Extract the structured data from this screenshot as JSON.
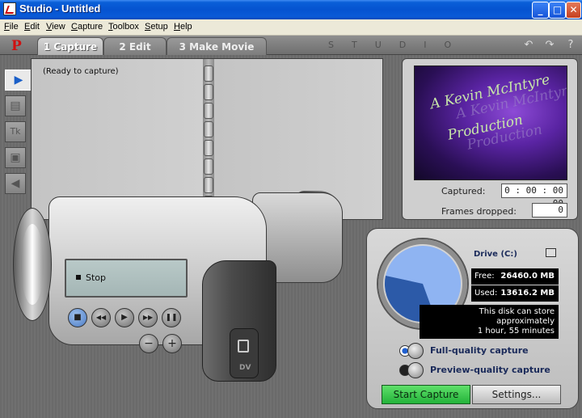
{
  "window": {
    "title": "Studio - Untitled",
    "controls": {
      "minimize": "_",
      "maximize": "□",
      "close": "✕"
    }
  },
  "menu": [
    {
      "label": "File",
      "mnemonic": "F",
      "rest": "ile"
    },
    {
      "label": "Edit",
      "mnemonic": "E",
      "rest": "dit"
    },
    {
      "label": "View",
      "mnemonic": "V",
      "rest": "iew"
    },
    {
      "label": "Capture",
      "mnemonic": "C",
      "rest": "apture"
    },
    {
      "label": "Toolbox",
      "mnemonic": "T",
      "rest": "oolbox"
    },
    {
      "label": "Setup",
      "mnemonic": "S",
      "rest": "etup"
    },
    {
      "label": "Help",
      "mnemonic": "H",
      "rest": "elp"
    }
  ],
  "topbar": {
    "logo": "P",
    "tabs": [
      "1 Capture",
      "2 Edit",
      "3 Make Movie"
    ],
    "active_tab": "1 Capture",
    "brand": "STUDIO",
    "icons": [
      "undo-icon",
      "redo-icon",
      "help-icon"
    ],
    "icon_glyphs": {
      "undo": "↶",
      "redo": "↷",
      "help": "?"
    }
  },
  "tools": {
    "icons": [
      "video-capture-icon",
      "scene-icon",
      "title-icon",
      "still-image-icon",
      "audio-icon"
    ],
    "glyphs": [
      "▶",
      "▤",
      "Tk",
      "▣",
      "◀"
    ]
  },
  "album": {
    "status": "(Ready to capture)"
  },
  "preview": {
    "screen_lines": [
      "A Kevin McIntyre",
      "Production"
    ],
    "captured_label": "Captured:",
    "captured_value": "0 : 00 : 00 . 00",
    "frames_dropped_label": "Frames dropped:",
    "frames_dropped_value": "0"
  },
  "camcorder": {
    "lcd_text": "Stop",
    "controls": [
      "stop",
      "rewind",
      "play",
      "fast-forward",
      "pause",
      "volume-down",
      "volume-up"
    ],
    "control_glyphs": [
      "■",
      "◀◀",
      "▶",
      "▶▶",
      "❚❚",
      "−",
      "+"
    ],
    "port_label": "DV"
  },
  "drive": {
    "label": "Drive (C:)",
    "free_label": "Free:",
    "free_value": "26460.0 MB",
    "used_label": "Used:",
    "used_value": "13616.2 MB",
    "used_fraction": 0.34,
    "info_lines": [
      "This disk can store",
      "approximately",
      "1 hour, 55 minutes"
    ],
    "options": [
      "Full-quality capture",
      "Preview-quality capture"
    ],
    "selected_option": "Full-quality capture",
    "pie_colors": {
      "free": "#8fb4f2",
      "used": "#2c5aa8"
    }
  },
  "buttons": {
    "start_capture": "Start Capture",
    "settings": "Settings..."
  }
}
